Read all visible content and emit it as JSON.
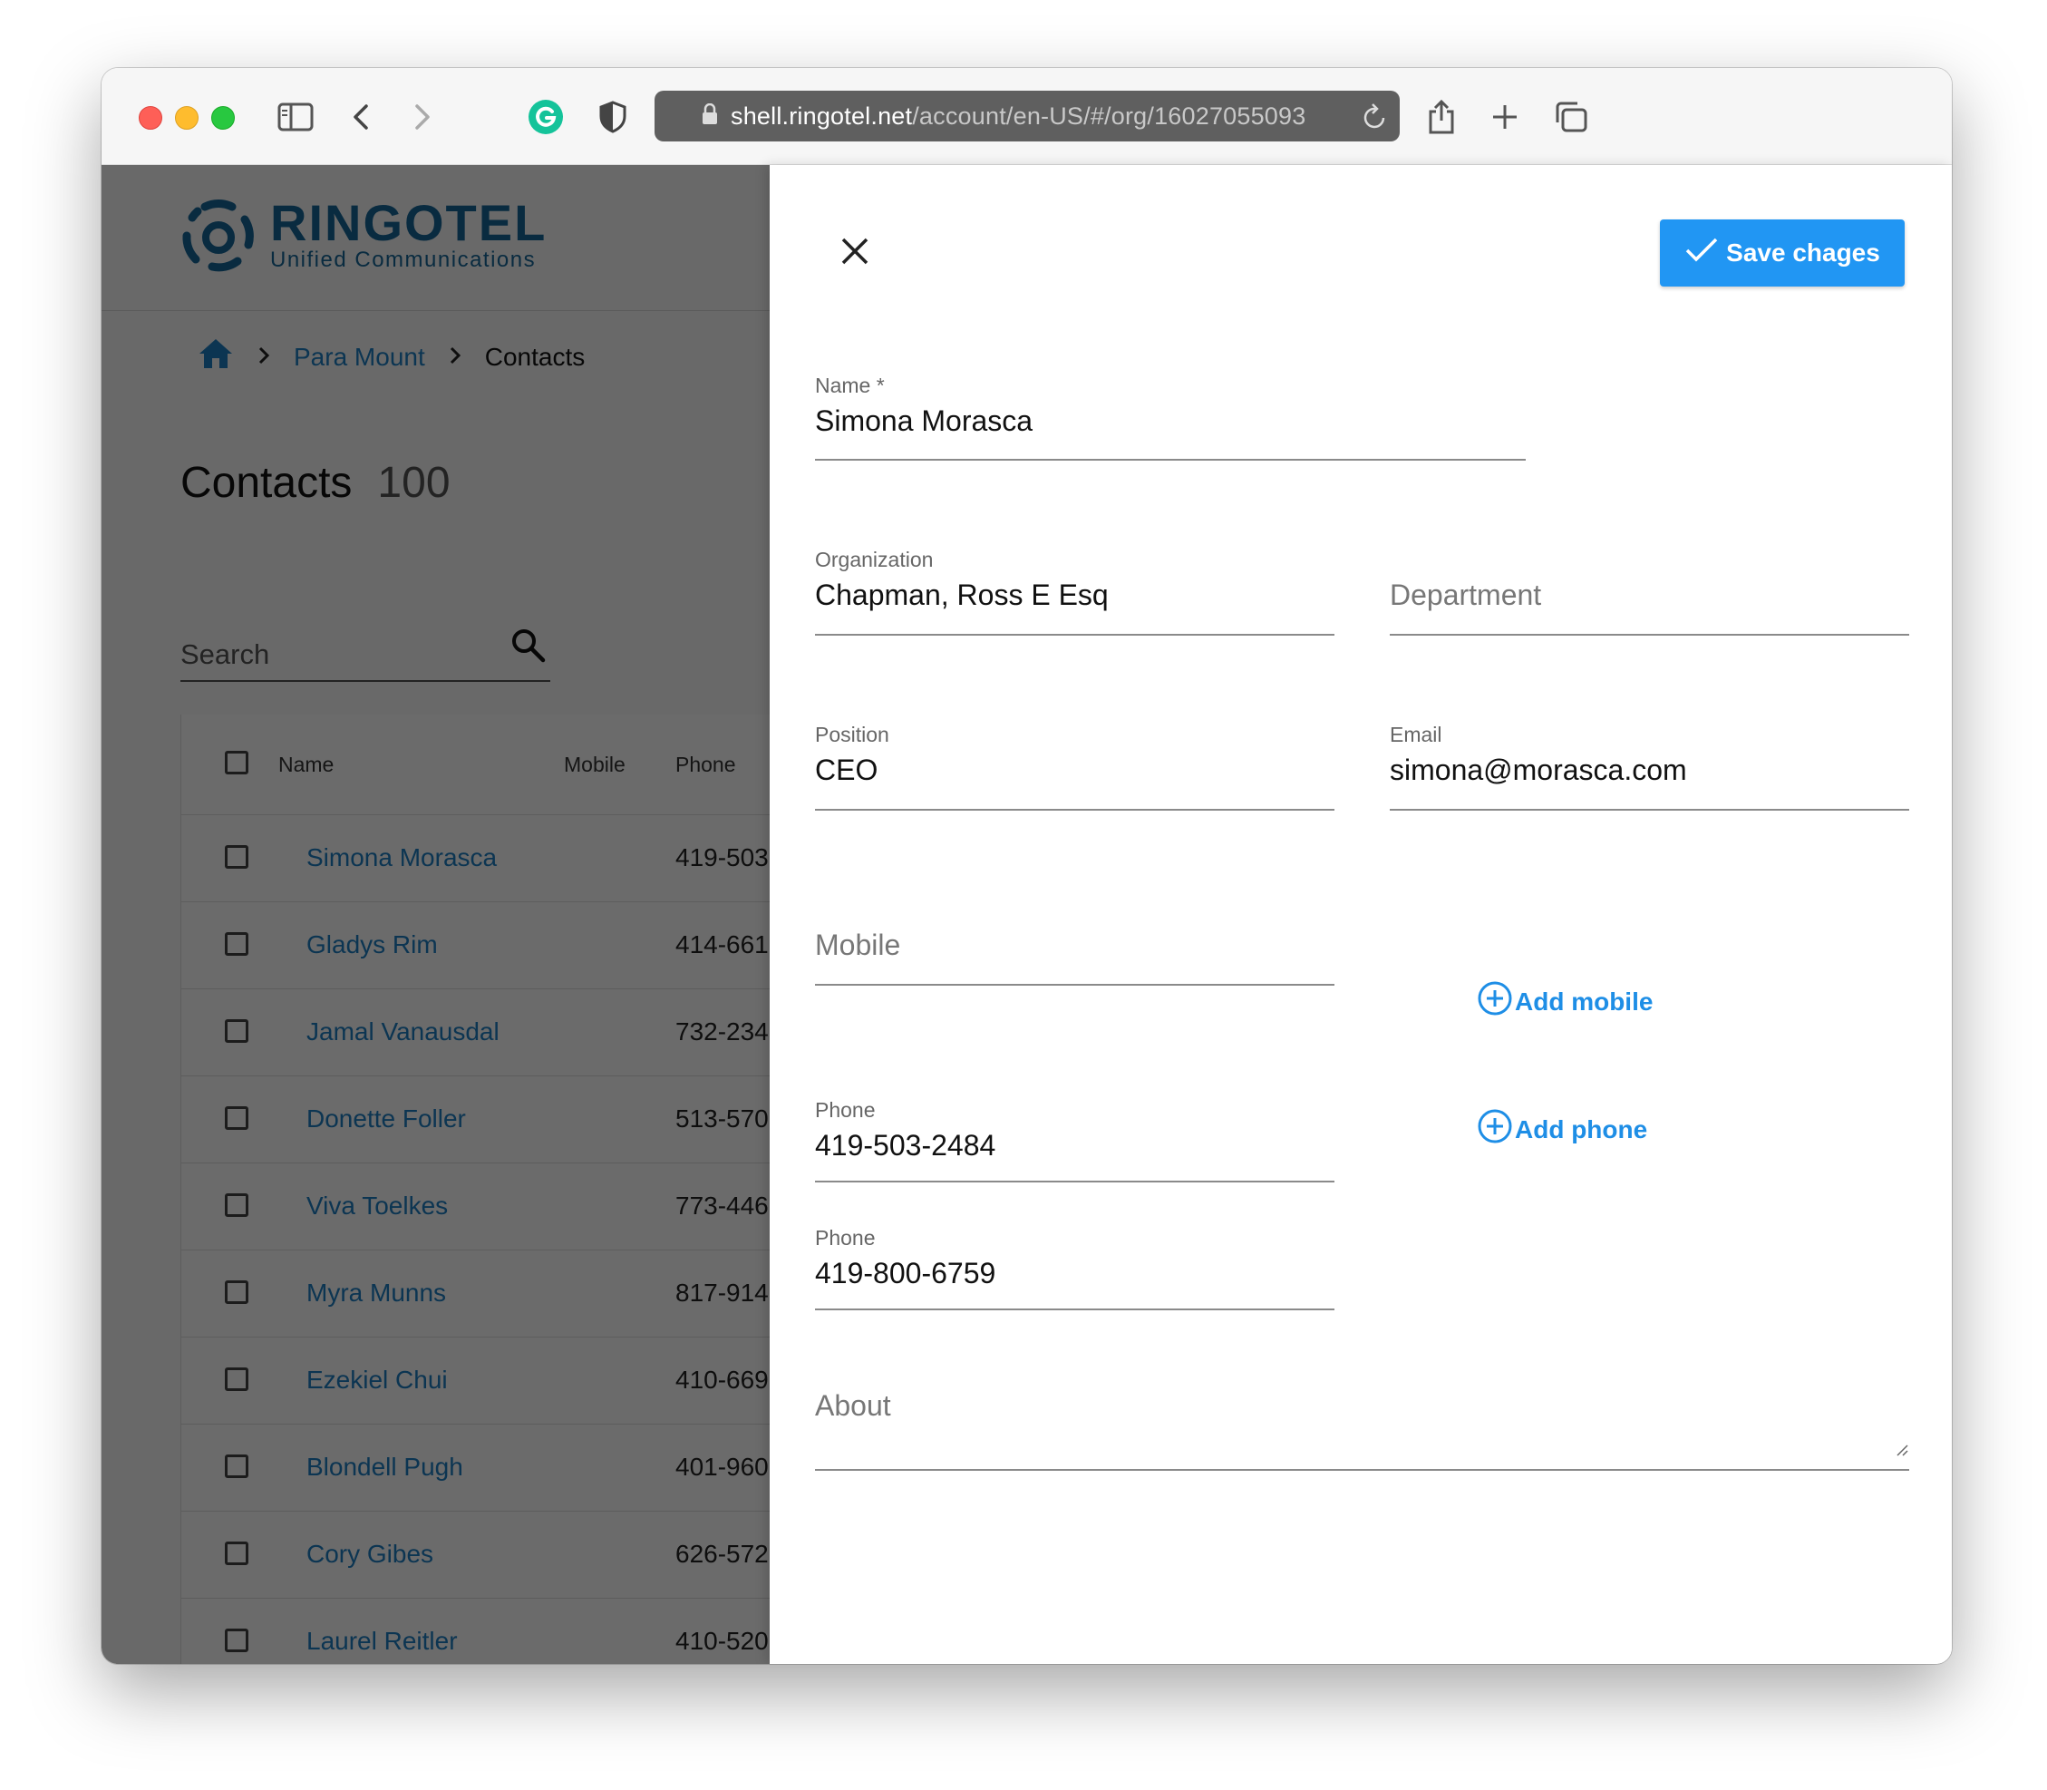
{
  "browser": {
    "url_host": "shell.ringotel.net",
    "url_path": "/account/en-US/#/org/16027055093"
  },
  "logo": {
    "title": "RINGOTEL",
    "subtitle": "Unified Communications"
  },
  "breadcrumb": {
    "items": [
      "Para Mount",
      "Contacts"
    ]
  },
  "contacts_page": {
    "title": "Contacts",
    "count": "100",
    "search_placeholder": "Search",
    "columns": {
      "name": "Name",
      "mobile": "Mobile",
      "phone": "Phone"
    },
    "rows": [
      {
        "name": "Simona Morasca",
        "phone": "419-503"
      },
      {
        "name": "Gladys Rim",
        "phone": "414-661"
      },
      {
        "name": "Jamal Vanausdal",
        "phone": "732-234"
      },
      {
        "name": "Donette Foller",
        "phone": "513-570"
      },
      {
        "name": "Viva Toelkes",
        "phone": "773-446"
      },
      {
        "name": "Myra Munns",
        "phone": "817-914"
      },
      {
        "name": "Ezekiel Chui",
        "phone": "410-669"
      },
      {
        "name": "Blondell Pugh",
        "phone": "401-960"
      },
      {
        "name": "Cory Gibes",
        "phone": "626-572"
      },
      {
        "name": "Laurel Reitler",
        "phone": "410-520"
      }
    ]
  },
  "editor": {
    "save_label": "Save chages",
    "name_label": "Name *",
    "name_value": "Simona Morasca",
    "organization_label": "Organization",
    "organization_value": "Chapman, Ross E Esq",
    "department_placeholder": "Department",
    "position_label": "Position",
    "position_value": "CEO",
    "email_label": "Email",
    "email_value": "simona@morasca.com",
    "mobile_placeholder": "Mobile",
    "add_mobile_label": "Add mobile",
    "phone_label": "Phone",
    "phone_1_value": "419-503-2484",
    "phone_2_value": "419-800-6759",
    "add_phone_label": "Add phone",
    "about_placeholder": "About"
  },
  "colors": {
    "accent": "#2196f3",
    "link": "#1e7fc4",
    "brand": "#17689a"
  }
}
